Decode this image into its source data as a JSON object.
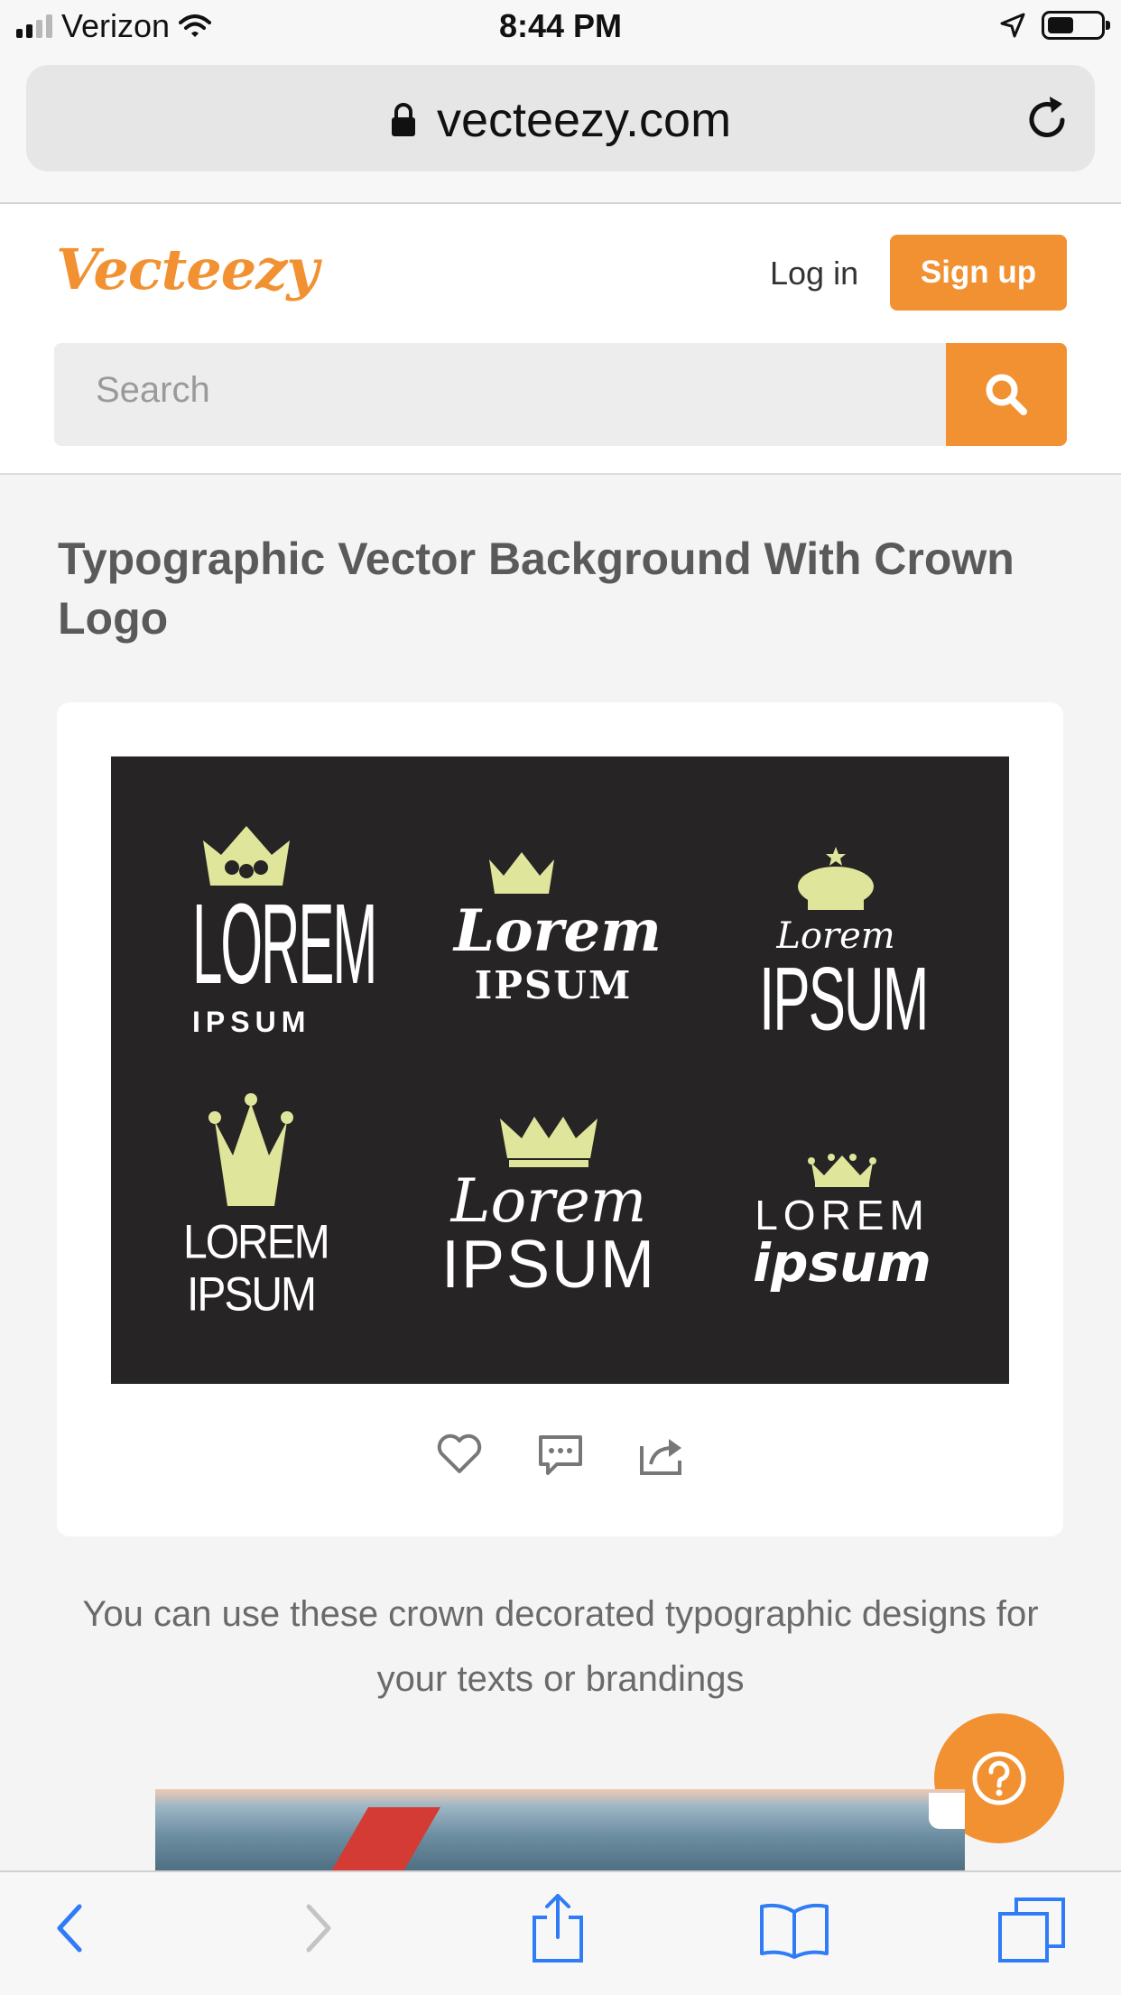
{
  "status_bar": {
    "carrier": "Verizon",
    "time": "8:44 PM",
    "battery_level": 0.45
  },
  "browser": {
    "url": "vecteezy.com"
  },
  "site": {
    "logo": "Vecteezy",
    "login_label": "Log in",
    "signup_label": "Sign up",
    "search_placeholder": "Search"
  },
  "page": {
    "title": "Typographic Vector Background With Crown Logo",
    "description": "You can use these crown decorated typographic designs for your texts or brandings"
  },
  "artwork": {
    "tiles": [
      {
        "line1": "LOREM",
        "line2": "IPSUM"
      },
      {
        "line1": "Lorem",
        "line2": "IPSUM"
      },
      {
        "line1": "Lorem",
        "line2": "IPSUM"
      },
      {
        "line1": "LOREM",
        "line2": "IPSUM"
      },
      {
        "line1": "Lorem",
        "line2": "IPSUM"
      },
      {
        "line1": "LOREM",
        "line2": "ipsum"
      }
    ]
  },
  "colors": {
    "accent": "#f29132",
    "crown": "#dfe59a",
    "artwork_bg": "#262424"
  },
  "icons": [
    "lock-icon",
    "reload-icon",
    "search-icon",
    "heart-icon",
    "comment-icon",
    "share-icon",
    "help-icon",
    "back-icon",
    "forward-icon",
    "share-sheet-icon",
    "bookmarks-icon",
    "tabs-icon"
  ]
}
